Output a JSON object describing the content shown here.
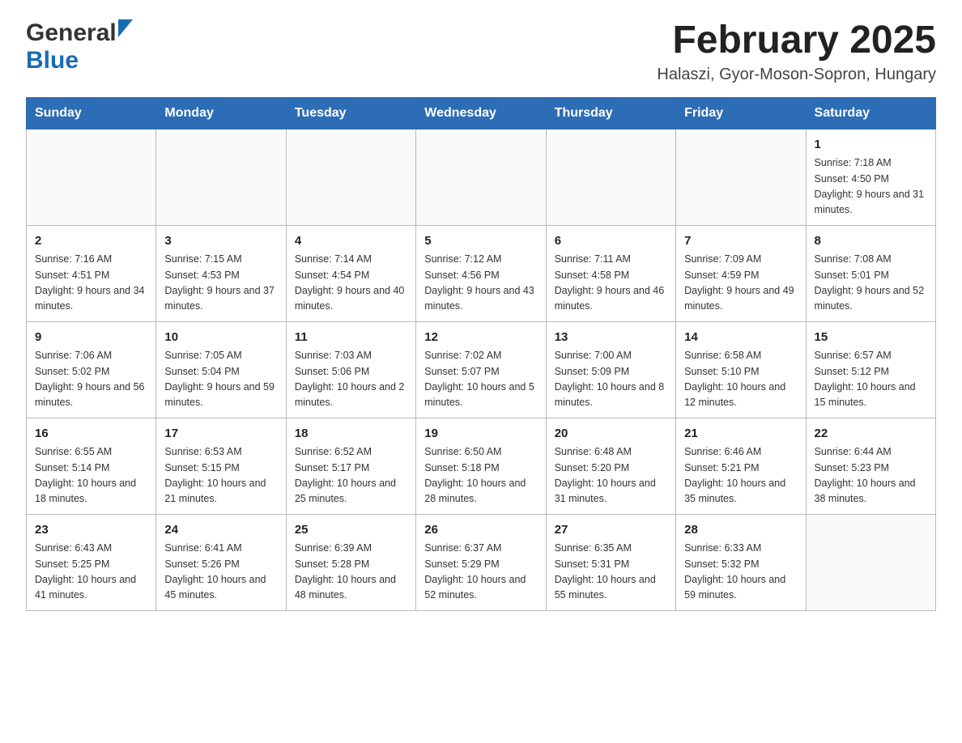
{
  "header": {
    "logo_general": "General",
    "logo_blue": "Blue",
    "month_title": "February 2025",
    "location": "Halaszi, Gyor-Moson-Sopron, Hungary"
  },
  "days_of_week": [
    "Sunday",
    "Monday",
    "Tuesday",
    "Wednesday",
    "Thursday",
    "Friday",
    "Saturday"
  ],
  "weeks": [
    {
      "days": [
        {
          "number": "",
          "info": ""
        },
        {
          "number": "",
          "info": ""
        },
        {
          "number": "",
          "info": ""
        },
        {
          "number": "",
          "info": ""
        },
        {
          "number": "",
          "info": ""
        },
        {
          "number": "",
          "info": ""
        },
        {
          "number": "1",
          "info": "Sunrise: 7:18 AM\nSunset: 4:50 PM\nDaylight: 9 hours\nand 31 minutes."
        }
      ]
    },
    {
      "days": [
        {
          "number": "2",
          "info": "Sunrise: 7:16 AM\nSunset: 4:51 PM\nDaylight: 9 hours\nand 34 minutes."
        },
        {
          "number": "3",
          "info": "Sunrise: 7:15 AM\nSunset: 4:53 PM\nDaylight: 9 hours\nand 37 minutes."
        },
        {
          "number": "4",
          "info": "Sunrise: 7:14 AM\nSunset: 4:54 PM\nDaylight: 9 hours\nand 40 minutes."
        },
        {
          "number": "5",
          "info": "Sunrise: 7:12 AM\nSunset: 4:56 PM\nDaylight: 9 hours\nand 43 minutes."
        },
        {
          "number": "6",
          "info": "Sunrise: 7:11 AM\nSunset: 4:58 PM\nDaylight: 9 hours\nand 46 minutes."
        },
        {
          "number": "7",
          "info": "Sunrise: 7:09 AM\nSunset: 4:59 PM\nDaylight: 9 hours\nand 49 minutes."
        },
        {
          "number": "8",
          "info": "Sunrise: 7:08 AM\nSunset: 5:01 PM\nDaylight: 9 hours\nand 52 minutes."
        }
      ]
    },
    {
      "days": [
        {
          "number": "9",
          "info": "Sunrise: 7:06 AM\nSunset: 5:02 PM\nDaylight: 9 hours\nand 56 minutes."
        },
        {
          "number": "10",
          "info": "Sunrise: 7:05 AM\nSunset: 5:04 PM\nDaylight: 9 hours\nand 59 minutes."
        },
        {
          "number": "11",
          "info": "Sunrise: 7:03 AM\nSunset: 5:06 PM\nDaylight: 10 hours\nand 2 minutes."
        },
        {
          "number": "12",
          "info": "Sunrise: 7:02 AM\nSunset: 5:07 PM\nDaylight: 10 hours\nand 5 minutes."
        },
        {
          "number": "13",
          "info": "Sunrise: 7:00 AM\nSunset: 5:09 PM\nDaylight: 10 hours\nand 8 minutes."
        },
        {
          "number": "14",
          "info": "Sunrise: 6:58 AM\nSunset: 5:10 PM\nDaylight: 10 hours\nand 12 minutes."
        },
        {
          "number": "15",
          "info": "Sunrise: 6:57 AM\nSunset: 5:12 PM\nDaylight: 10 hours\nand 15 minutes."
        }
      ]
    },
    {
      "days": [
        {
          "number": "16",
          "info": "Sunrise: 6:55 AM\nSunset: 5:14 PM\nDaylight: 10 hours\nand 18 minutes."
        },
        {
          "number": "17",
          "info": "Sunrise: 6:53 AM\nSunset: 5:15 PM\nDaylight: 10 hours\nand 21 minutes."
        },
        {
          "number": "18",
          "info": "Sunrise: 6:52 AM\nSunset: 5:17 PM\nDaylight: 10 hours\nand 25 minutes."
        },
        {
          "number": "19",
          "info": "Sunrise: 6:50 AM\nSunset: 5:18 PM\nDaylight: 10 hours\nand 28 minutes."
        },
        {
          "number": "20",
          "info": "Sunrise: 6:48 AM\nSunset: 5:20 PM\nDaylight: 10 hours\nand 31 minutes."
        },
        {
          "number": "21",
          "info": "Sunrise: 6:46 AM\nSunset: 5:21 PM\nDaylight: 10 hours\nand 35 minutes."
        },
        {
          "number": "22",
          "info": "Sunrise: 6:44 AM\nSunset: 5:23 PM\nDaylight: 10 hours\nand 38 minutes."
        }
      ]
    },
    {
      "days": [
        {
          "number": "23",
          "info": "Sunrise: 6:43 AM\nSunset: 5:25 PM\nDaylight: 10 hours\nand 41 minutes."
        },
        {
          "number": "24",
          "info": "Sunrise: 6:41 AM\nSunset: 5:26 PM\nDaylight: 10 hours\nand 45 minutes."
        },
        {
          "number": "25",
          "info": "Sunrise: 6:39 AM\nSunset: 5:28 PM\nDaylight: 10 hours\nand 48 minutes."
        },
        {
          "number": "26",
          "info": "Sunrise: 6:37 AM\nSunset: 5:29 PM\nDaylight: 10 hours\nand 52 minutes."
        },
        {
          "number": "27",
          "info": "Sunrise: 6:35 AM\nSunset: 5:31 PM\nDaylight: 10 hours\nand 55 minutes."
        },
        {
          "number": "28",
          "info": "Sunrise: 6:33 AM\nSunset: 5:32 PM\nDaylight: 10 hours\nand 59 minutes."
        },
        {
          "number": "",
          "info": ""
        }
      ]
    }
  ]
}
